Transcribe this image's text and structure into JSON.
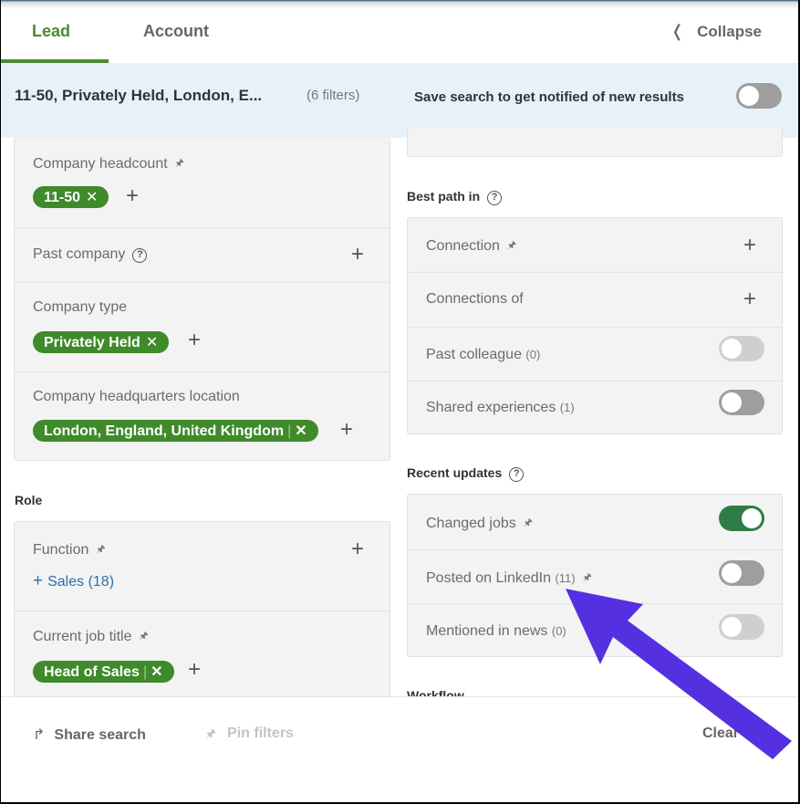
{
  "tabs": [
    {
      "label": "Lead",
      "active": true
    },
    {
      "label": "Account",
      "active": false
    }
  ],
  "collapse_label": "Collapse",
  "banner": {
    "summary": "11-50, Privately Held, London, E...",
    "filter_count": "(6 filters)",
    "save_label": "Save search to get notified of new results",
    "save_enabled": false
  },
  "left": {
    "company_headcount": {
      "label": "Company headcount",
      "chip": "11-50"
    },
    "past_company": {
      "label": "Past company"
    },
    "company_type": {
      "label": "Company type",
      "chip": "Privately Held"
    },
    "hq_location": {
      "label": "Company headquarters location",
      "chip": "London, England, United Kingdom"
    },
    "role_title": "Role",
    "function": {
      "label": "Function",
      "suggestion": "Sales (18)"
    },
    "current_job_title": {
      "label": "Current job title",
      "chip": "Head of Sales"
    }
  },
  "right": {
    "best_path_title": "Best path in",
    "best_path": [
      {
        "label": "Connection",
        "pinned": true,
        "control": "plus"
      },
      {
        "label": "Connections of",
        "pinned": false,
        "control": "plus"
      },
      {
        "label": "Past colleague",
        "count": "(0)",
        "control": "toggle",
        "on": false,
        "disabled": true
      },
      {
        "label": "Shared experiences",
        "count": "(1)",
        "control": "toggle",
        "on": false,
        "disabled": false
      }
    ],
    "recent_updates_title": "Recent updates",
    "recent_updates": [
      {
        "label": "Changed jobs",
        "pinned": true,
        "on": true,
        "disabled": false
      },
      {
        "label": "Posted on LinkedIn",
        "count": "(11)",
        "pinned": true,
        "on": false,
        "disabled": false
      },
      {
        "label": "Mentioned in news",
        "count": "(0)",
        "on": false,
        "disabled": true
      }
    ],
    "workflow_title": "Workflow"
  },
  "footer": {
    "share_label": "Share search",
    "pin_label": "Pin filters",
    "clear_label": "Clear all"
  },
  "icons": {
    "pin": "🖈",
    "help": "?",
    "plus": "+",
    "close": "✕",
    "chevron_left": "❬",
    "share": "↱"
  },
  "colors": {
    "accent_green": "#4a8a33",
    "chip_green": "#3f8a2b",
    "toggle_on": "#2e7d46",
    "banner_bg": "#e6f2f8",
    "link_blue": "#2c6ea8",
    "annotation_arrow": "#5530e0"
  }
}
